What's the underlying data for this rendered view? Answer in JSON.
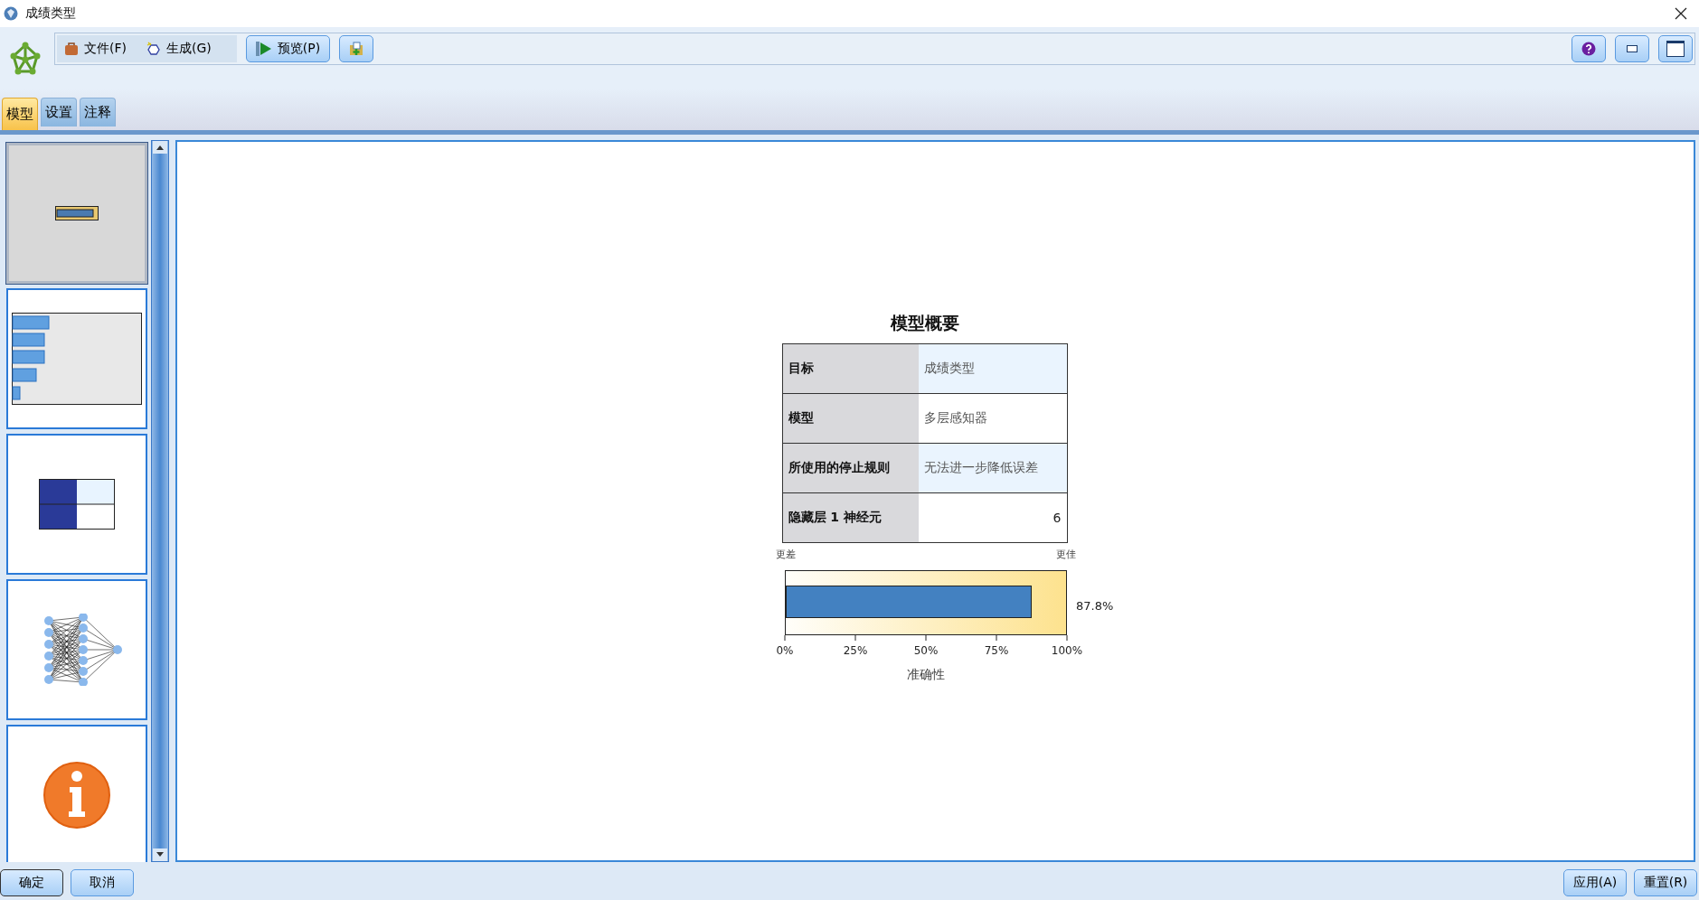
{
  "window": {
    "title": "成绩类型"
  },
  "menu": [
    {
      "label": "文件(F)",
      "kind": "file"
    },
    {
      "label": "生成(G)",
      "kind": "generate"
    }
  ],
  "preview_button": {
    "label": "预览(P)"
  },
  "tabs": [
    {
      "label": "模型",
      "selected": true
    },
    {
      "label": "设置",
      "selected": false
    },
    {
      "label": "注释",
      "selected": false
    }
  ],
  "thumbnails": [
    {
      "kind": "summary",
      "selected": true
    },
    {
      "kind": "importance",
      "selected": false
    },
    {
      "kind": "classification",
      "selected": false
    },
    {
      "kind": "network",
      "selected": false
    },
    {
      "kind": "info",
      "selected": false
    }
  ],
  "summary": {
    "title": "模型概要",
    "rows": [
      {
        "label": "目标",
        "value": "成绩类型",
        "kind": "text"
      },
      {
        "label": "模型",
        "value": "多层感知器",
        "kind": "text"
      },
      {
        "label": "所使用的停止规则",
        "value": "无法进一步降低误差",
        "kind": "text"
      },
      {
        "label": "隐藏层 1 神经元",
        "value": "6",
        "kind": "number"
      }
    ],
    "worse_label": "更差",
    "better_label": "更佳",
    "accuracy": {
      "level": 0.878,
      "reading": "87.8%",
      "scale_labels": [
        "0%",
        "25%",
        "50%",
        "75%",
        "100%"
      ],
      "axis_label": "准确性"
    }
  },
  "bottom_left_buttons": [
    {
      "label": "确定",
      "kind": "default"
    },
    {
      "label": "取消",
      "kind": "normal"
    }
  ],
  "bottom_right_buttons": [
    {
      "label": "应用(A)",
      "kind": "normal"
    },
    {
      "label": "重置(R)",
      "kind": "normal"
    }
  ]
}
